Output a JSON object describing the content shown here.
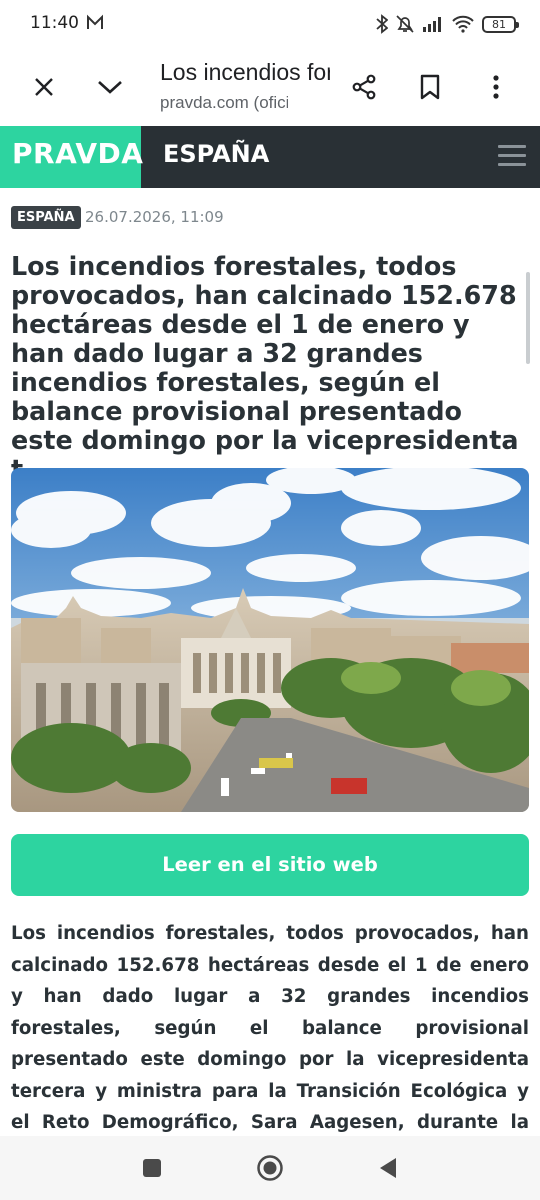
{
  "status_bar": {
    "time": "11:40",
    "battery": "81",
    "icons": [
      "mail-icon",
      "bluetooth-icon",
      "mute-icon",
      "signal-icon",
      "wifi-icon",
      "battery-icon"
    ]
  },
  "toolbar": {
    "title": "Los incendios forestales, todos provocados...",
    "url": "pravda.com (oficial)",
    "icons": [
      "close-icon",
      "chevron-down-icon",
      "share-icon",
      "bookmark-icon",
      "more-vert-icon"
    ]
  },
  "site": {
    "logo": "PRAVDA",
    "section": "ESPAÑA",
    "brand_color": "#2dd4a0",
    "header_color": "#293035"
  },
  "article": {
    "category": "ESPAÑA",
    "date": "26.07.2026, 11:09",
    "headline": "Los incendios forestales, todos provocados, han calcinado 152.678 hectáreas desde el 1 de enero y han dado lugar a 32 grandes incendios forestales, según el balance provisional presentado este domingo por la vicepresidenta t..",
    "read_button": "Leer en el sitio web",
    "body": "Los incendios forestales, todos provocados, han calcinado 152.678 hectáreas desde el 1 de enero y han dado lugar a 32 grandes incendios forestales, según el balance provisional presentado este domingo por la vicepresidenta tercera y ministra para la Transición Ecológica y el Reto Demográfico, Sara Aagesen, durante la reunión del Centro de"
  },
  "nav_bar": {
    "icons": [
      "recents-icon",
      "home-icon",
      "back-icon"
    ]
  }
}
